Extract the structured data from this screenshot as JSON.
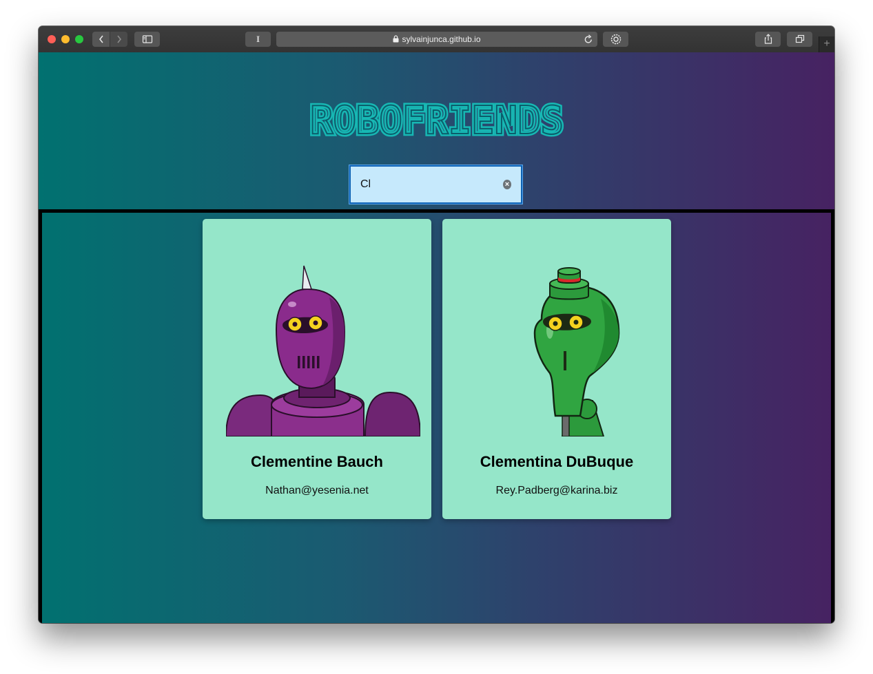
{
  "browser": {
    "url": "sylvainjunca.github.io",
    "reader_label": "I"
  },
  "app": {
    "title": "ROBOFRIENDS",
    "accent_color": "#17b8b4",
    "search": {
      "value": "Cl",
      "placeholder": ""
    },
    "robots": [
      {
        "name": "Clementine Bauch",
        "email": "Nathan@yesenia.net",
        "color": "purple"
      },
      {
        "name": "Clementina DuBuque",
        "email": "Rey.Padberg@karina.biz",
        "color": "green"
      }
    ]
  }
}
